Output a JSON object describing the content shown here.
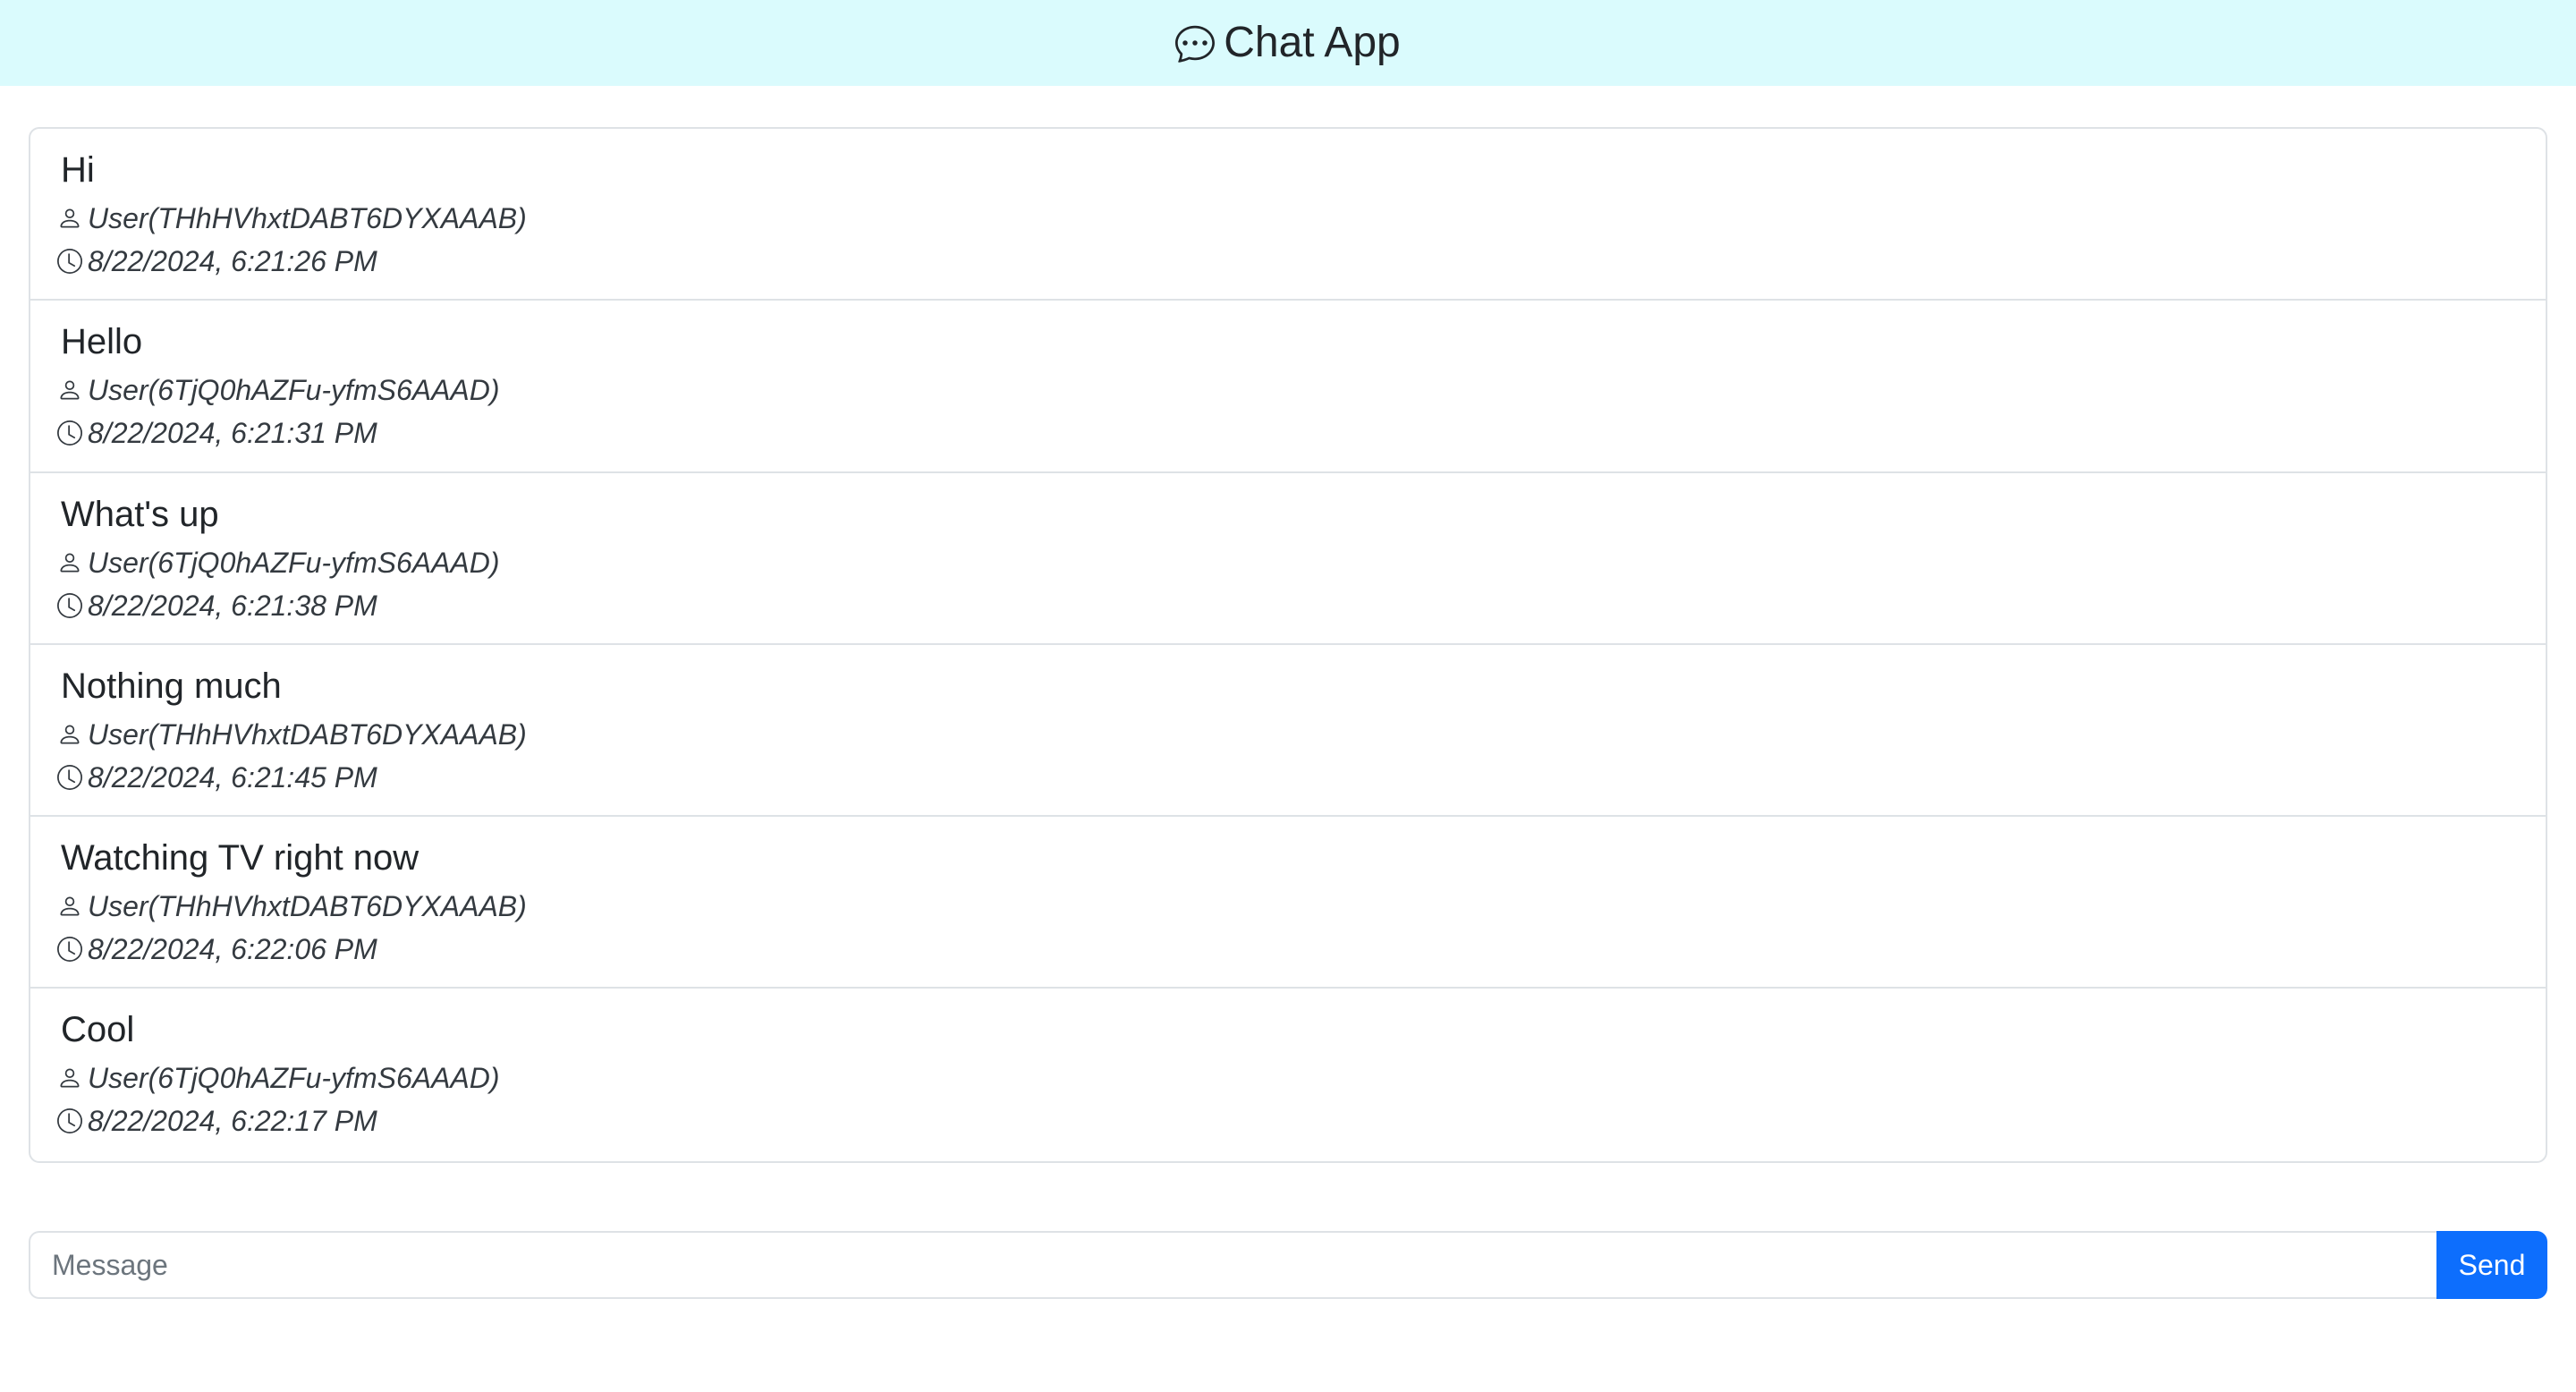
{
  "header": {
    "title": "Chat App",
    "icon": "chat-dots-icon"
  },
  "messages": [
    {
      "text": "Hi",
      "user": "User(THhHVhxtDABT6DYXAAAB)",
      "time": "8/22/2024, 6:21:26 PM"
    },
    {
      "text": "Hello",
      "user": "User(6TjQ0hAZFu-yfmS6AAAD)",
      "time": "8/22/2024, 6:21:31 PM"
    },
    {
      "text": "What's up",
      "user": "User(6TjQ0hAZFu-yfmS6AAAD)",
      "time": "8/22/2024, 6:21:38 PM"
    },
    {
      "text": "Nothing much",
      "user": "User(THhHVhxtDABT6DYXAAAB)",
      "time": "8/22/2024, 6:21:45 PM"
    },
    {
      "text": "Watching TV right now",
      "user": "User(THhHVhxtDABT6DYXAAAB)",
      "time": "8/22/2024, 6:22:06 PM"
    },
    {
      "text": "Cool",
      "user": "User(6TjQ0hAZFu-yfmS6AAAD)",
      "time": "8/22/2024, 6:22:17 PM"
    }
  ],
  "composer": {
    "placeholder": "Message",
    "value": "",
    "send_label": "Send"
  },
  "colors": {
    "header_bg": "#dafbfd",
    "send_button": "#0d6efd",
    "border": "#dee2e6"
  }
}
